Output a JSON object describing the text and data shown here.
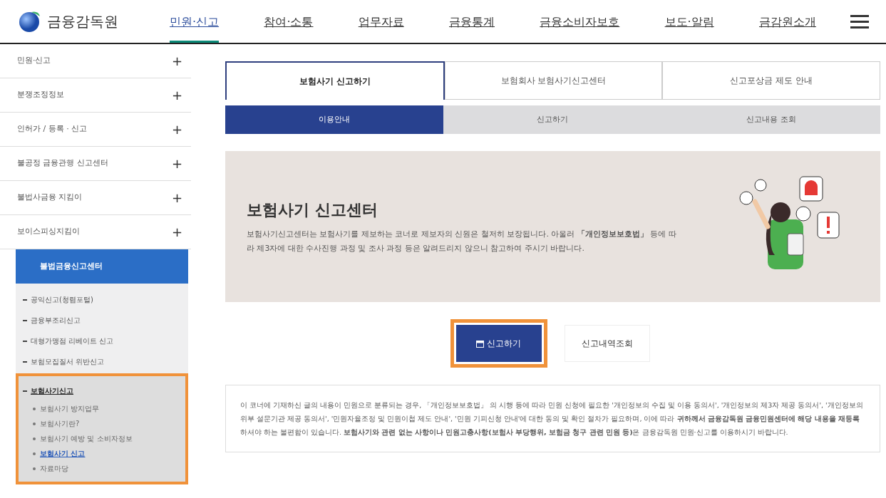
{
  "header": {
    "logo_text": "금융감독원",
    "menu": [
      {
        "label": "민원·신고",
        "selected": true
      },
      {
        "label": "참여·소통",
        "selected": false
      },
      {
        "label": "업무자료",
        "selected": false
      },
      {
        "label": "금융통계",
        "selected": false
      },
      {
        "label": "금융소비자보호",
        "selected": false
      },
      {
        "label": "보도·알림",
        "selected": false
      },
      {
        "label": "금감원소개",
        "selected": false
      }
    ]
  },
  "sidebar": {
    "items": [
      {
        "label": "민원·신고",
        "toggle": "+",
        "expanded": false
      },
      {
        "label": "분쟁조정정보",
        "toggle": "+",
        "expanded": false
      },
      {
        "label": "인허가 / 등록 · 신고",
        "toggle": "+",
        "expanded": false
      },
      {
        "label": "불공정 금융관행 신고센터",
        "toggle": "+",
        "expanded": false
      },
      {
        "label": "불법사금융 지킴이",
        "toggle": "+",
        "expanded": false
      },
      {
        "label": "보이스피싱지킴이",
        "toggle": "+",
        "expanded": false
      },
      {
        "label": "불법금융신고센터",
        "expanded": true,
        "children": [
          {
            "label": "공익신고(청렴포털)",
            "selected": false,
            "highlighted": false
          },
          {
            "label": "금융부조리신고",
            "selected": false,
            "highlighted": false
          },
          {
            "label": "대형가맹점 리베이트 신고",
            "selected": false,
            "highlighted": false
          },
          {
            "label": "보험모집질서 위반신고",
            "selected": false,
            "highlighted": false
          },
          {
            "label": "보험사기신고",
            "selected": true,
            "highlighted": true,
            "children": [
              {
                "label": "보험사기 방지업무",
                "selected": false
              },
              {
                "label": "보험사기란?",
                "selected": false
              },
              {
                "label": "보험사기 예방 및 소비자정보",
                "selected": false
              },
              {
                "label": "보험사기 신고",
                "selected": true
              },
              {
                "label": "자료마당",
                "selected": false
              }
            ]
          }
        ]
      }
    ]
  },
  "tabs": [
    {
      "label": "보험사기 신고하기",
      "selected": true
    },
    {
      "label": "보험회사 보험사기신고센터",
      "selected": false
    },
    {
      "label": "신고포상금 제도 안내",
      "selected": false
    }
  ],
  "subtabs": [
    {
      "label": "이용안내",
      "selected": true
    },
    {
      "label": "신고하기",
      "selected": false
    },
    {
      "label": "신고내용 조회",
      "selected": false
    }
  ],
  "banner": {
    "title": "보험사기 신고센터",
    "text": "보험사기신고센터는 보험사기를 제보하는 코너로 제보자의 신원은 철저히 보장됩니다. 아울러 **「개인정보보호법」** 등에 따라 제3자에 대한 수사진행 과정 및 조사 과정 등은 알려드리지 않으니 참고하여 주시기 바랍니다."
  },
  "buttons": [
    {
      "label": "신고하기",
      "kind": "primary",
      "highlighted": true
    },
    {
      "label": "신고내역조회",
      "kind": "secondary",
      "highlighted": false
    }
  ],
  "notice": "이 코너에 기재하신 글의 내용이 민원으로 분류되는 경우, 「개인정보보호법」 의 시행 등에 따라 민원 신청에 필요한 '개인정보의 수집 및 이용 동의서', '개인정보의 제3자 제공 동의서', '개인정보의 위부 설문기관 제공 동의서', '민원자율조정 및 민원이첩 제도 안내', '민원 기피신청 안내'에 대한 동의 및 확인 절차가 필요하며, 이에 따라 **귀하께서 금융감독원 금융민원센터에 해당 내용을 재등록**하셔야 하는 불편함이 있습니다. **보험사기와 관련 없는 사항이나 민원고충사항(보험사 부당행위, 보험금 청구 관련 민원 등)**은 금융감독원 민원·신고를 이용하시기 바랍니다."
}
